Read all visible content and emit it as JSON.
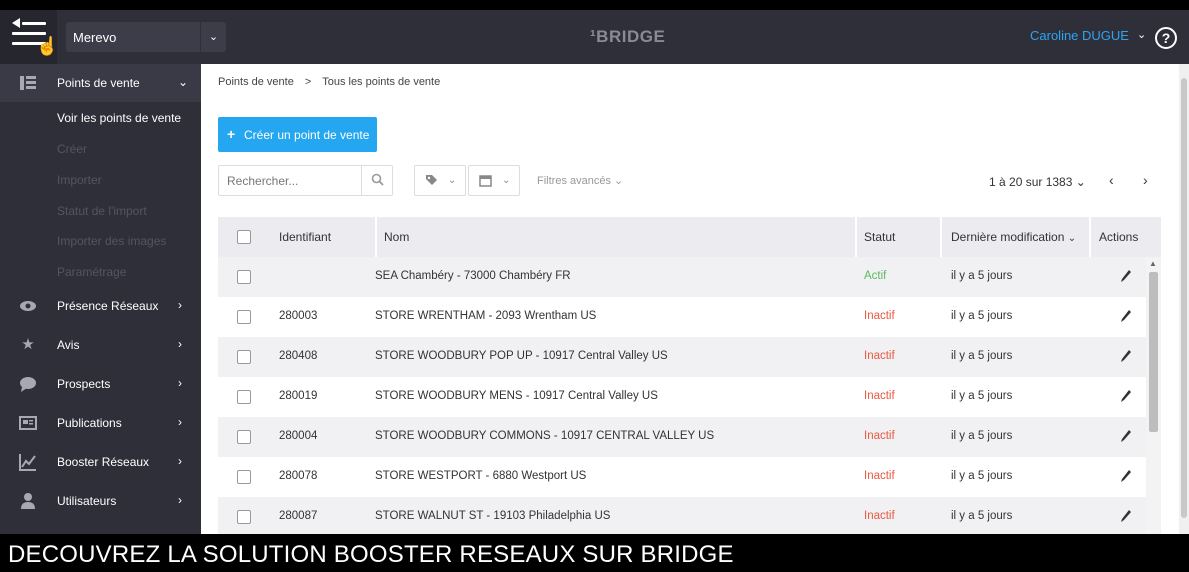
{
  "header": {
    "org_select": "Merevo",
    "brand": "¹BRIDGE",
    "user_name": "Caroline DUGUE"
  },
  "sidebar": {
    "items": [
      {
        "label": "Points de vente",
        "icon": "list-icon"
      },
      {
        "label": "Présence Réseaux",
        "icon": "eye-icon"
      },
      {
        "label": "Avis",
        "icon": "star-icon"
      },
      {
        "label": "Prospects",
        "icon": "chat-bubble-icon"
      },
      {
        "label": "Publications",
        "icon": "newspaper-icon"
      },
      {
        "label": "Booster Réseaux",
        "icon": "chart-icon"
      },
      {
        "label": "Utilisateurs",
        "icon": "user-icon"
      }
    ],
    "subitems": [
      "Voir les points de vente",
      "Créer",
      "Importer",
      "Statut de l'import",
      "Importer des images",
      "Paramétrage"
    ]
  },
  "breadcrumb": {
    "root": "Points de vente",
    "separator": ">",
    "current": "Tous les points de vente"
  },
  "toolbar": {
    "create_label": "Créer un point de vente",
    "search_placeholder": "Rechercher...",
    "advanced_filters": "Filtres avancés",
    "pagination": "1 à 20 sur 1383"
  },
  "table": {
    "headers": {
      "id": "Identifiant",
      "name": "Nom",
      "status": "Statut",
      "modified": "Dernière modification",
      "actions": "Actions"
    },
    "rows": [
      {
        "id": "",
        "name": "SEA Chambéry - 73000 Chambéry FR",
        "status": "Actif",
        "modified": "il y a 5 jours"
      },
      {
        "id": "280003",
        "name": "STORE WRENTHAM - 2093 Wrentham US",
        "status": "Inactif",
        "modified": "il y a 5 jours"
      },
      {
        "id": "280408",
        "name": "STORE WOODBURY POP UP - 10917 Central Valley US",
        "status": "Inactif",
        "modified": "il y a 5 jours"
      },
      {
        "id": "280019",
        "name": "STORE WOODBURY MENS - 10917 Central Valley US",
        "status": "Inactif",
        "modified": "il y a 5 jours"
      },
      {
        "id": "280004",
        "name": "STORE WOODBURY COMMONS - 10917 CENTRAL VALLEY US",
        "status": "Inactif",
        "modified": "il y a 5 jours"
      },
      {
        "id": "280078",
        "name": "STORE WESTPORT - 6880 Westport US",
        "status": "Inactif",
        "modified": "il y a 5 jours"
      },
      {
        "id": "280087",
        "name": "STORE WALNUT ST - 19103 Philadelphia US",
        "status": "Inactif",
        "modified": "il y a 5 jours"
      }
    ]
  },
  "caption": "DECOUVREZ LA SOLUTION BOOSTER RESEAUX SUR BRIDGE",
  "colors": {
    "accent": "#24a6f0",
    "sidebar_bg": "#2f2f3a",
    "status_active": "#5cb85c",
    "status_inactive": "#e9573f"
  }
}
